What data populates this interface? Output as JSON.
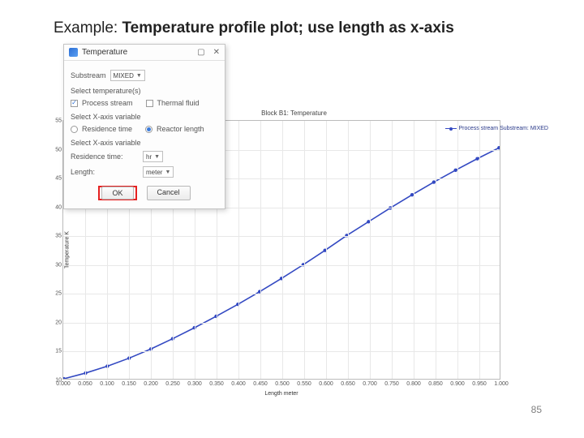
{
  "slide": {
    "title_prefix": "Example: ",
    "title_bold": "Temperature profile plot; use length as x-axis",
    "page_number": "85"
  },
  "dialog": {
    "title": "Temperature",
    "substream_label": "Substream",
    "substream_value": "MIXED",
    "select_temp_header": "Select temperature(s)",
    "process_stream_label": "Process stream",
    "process_stream_checked": true,
    "thermal_fluid_label": "Thermal fluid",
    "thermal_fluid_checked": false,
    "select_x_header": "Select X-axis variable",
    "residence_time_radio": "Residence time",
    "reactor_length_radio": "Reactor length",
    "x_selected": "reactor_length",
    "select_x_var_header": "Select X-axis variable",
    "residence_time_label": "Residence time:",
    "residence_time_unit": "hr",
    "length_label": "Length:",
    "length_unit": "meter",
    "ok_label": "OK",
    "cancel_label": "Cancel"
  },
  "chart_data": {
    "type": "line",
    "title": "Block B1: Temperature",
    "xlabel": "Length meter",
    "ylabel": "Temperature K",
    "xlim": [
      0,
      1.0
    ],
    "ylim": [
      10,
      55
    ],
    "xticks": [
      0.0,
      0.05,
      0.1,
      0.15,
      0.2,
      0.25,
      0.3,
      0.35,
      0.4,
      0.45,
      0.5,
      0.55,
      0.6,
      0.65,
      0.7,
      0.75,
      0.8,
      0.85,
      0.9,
      0.95,
      1.0
    ],
    "xtick_labels": [
      "0.000",
      "0.050",
      "0.100",
      "0.150",
      "0.200",
      "0.250",
      "0.300",
      "0.350",
      "0.400",
      "0.450",
      "0.500",
      "0.550",
      "0.600",
      "0.650",
      "0.700",
      "0.750",
      "0.800",
      "0.850",
      "0.900",
      "0.950",
      "1.000"
    ],
    "yticks": [
      10,
      15,
      20,
      25,
      30,
      35,
      40,
      45,
      50,
      55
    ],
    "series": [
      {
        "name": "Process stream Substream: MIXED",
        "color": "#3349c2",
        "x": [
          0.0,
          0.05,
          0.1,
          0.15,
          0.2,
          0.25,
          0.3,
          0.35,
          0.4,
          0.45,
          0.5,
          0.55,
          0.6,
          0.65,
          0.7,
          0.75,
          0.8,
          0.85,
          0.9,
          0.95,
          1.0
        ],
        "y": [
          10.0,
          11.0,
          12.2,
          13.6,
          15.2,
          17.0,
          18.9,
          20.9,
          23.0,
          25.2,
          27.5,
          29.9,
          32.4,
          35.0,
          37.4,
          39.8,
          42.1,
          44.3,
          46.4,
          48.4,
          50.3
        ]
      }
    ]
  }
}
